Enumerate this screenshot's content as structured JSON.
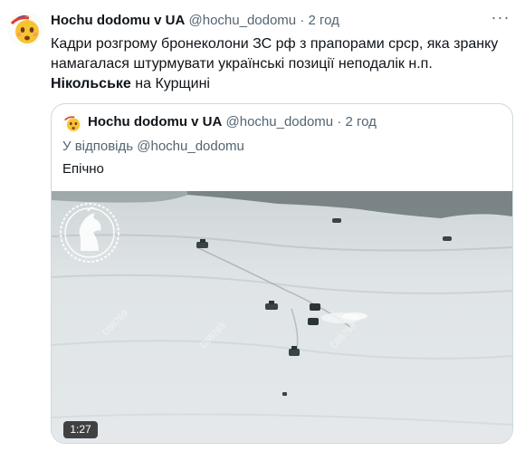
{
  "tweet": {
    "display_name": "Hochu dodomu v UA",
    "handle": "@hochu_dodomu",
    "separator": "·",
    "time": "2 год",
    "text_part1": "Кадри розгрому бронеколони ЗС рф з прапорами срср, яка зранку намагалася штурмувати українські позиції неподалік н.п. ",
    "text_bold": "Нікольське",
    "text_part2": " на Курщині"
  },
  "quoted_tweet": {
    "display_name": "Hochu dodomu v UA",
    "handle": "@hochu_dodomu",
    "separator": "·",
    "time": "2 год",
    "reply_to": "У відповідь @hochu_dodomu",
    "text": "Епічно"
  },
  "video": {
    "duration": "1:27",
    "watermark": "D88769",
    "colors": {
      "snow": "#dfe4e6",
      "treeline": "#5e6a6b",
      "vehicle": "#394446"
    }
  },
  "icons": {
    "avatar": "emoji-face-icon",
    "more": "more-options-icon",
    "unit_logo": "knight-horse-emblem-icon"
  }
}
